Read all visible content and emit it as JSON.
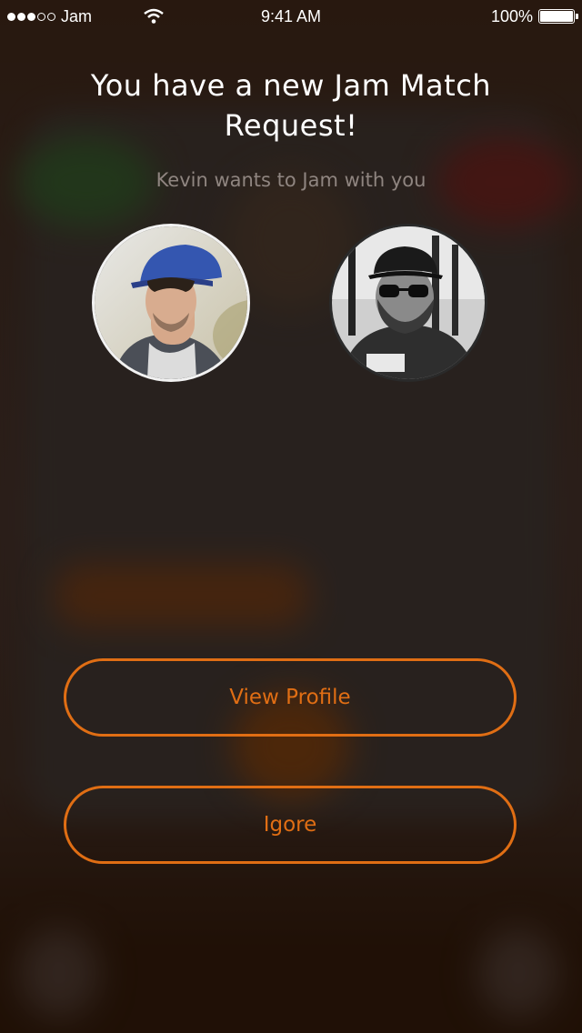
{
  "status_bar": {
    "carrier": "Jam",
    "time": "9:41 AM",
    "battery": "100%",
    "signal_bars_filled": 3,
    "signal_bars_total": 5
  },
  "modal": {
    "title": "You have a new Jam Match Request!",
    "subtitle": "Kevin wants to Jam with you",
    "requester_avatar": "requester-avatar",
    "user_avatar": "user-avatar"
  },
  "actions": {
    "view_profile": "View Profile",
    "ignore": "Igore"
  },
  "colors": {
    "accent": "#e06e14",
    "background": "#2a1508",
    "subtitle": "#8f8580"
  }
}
